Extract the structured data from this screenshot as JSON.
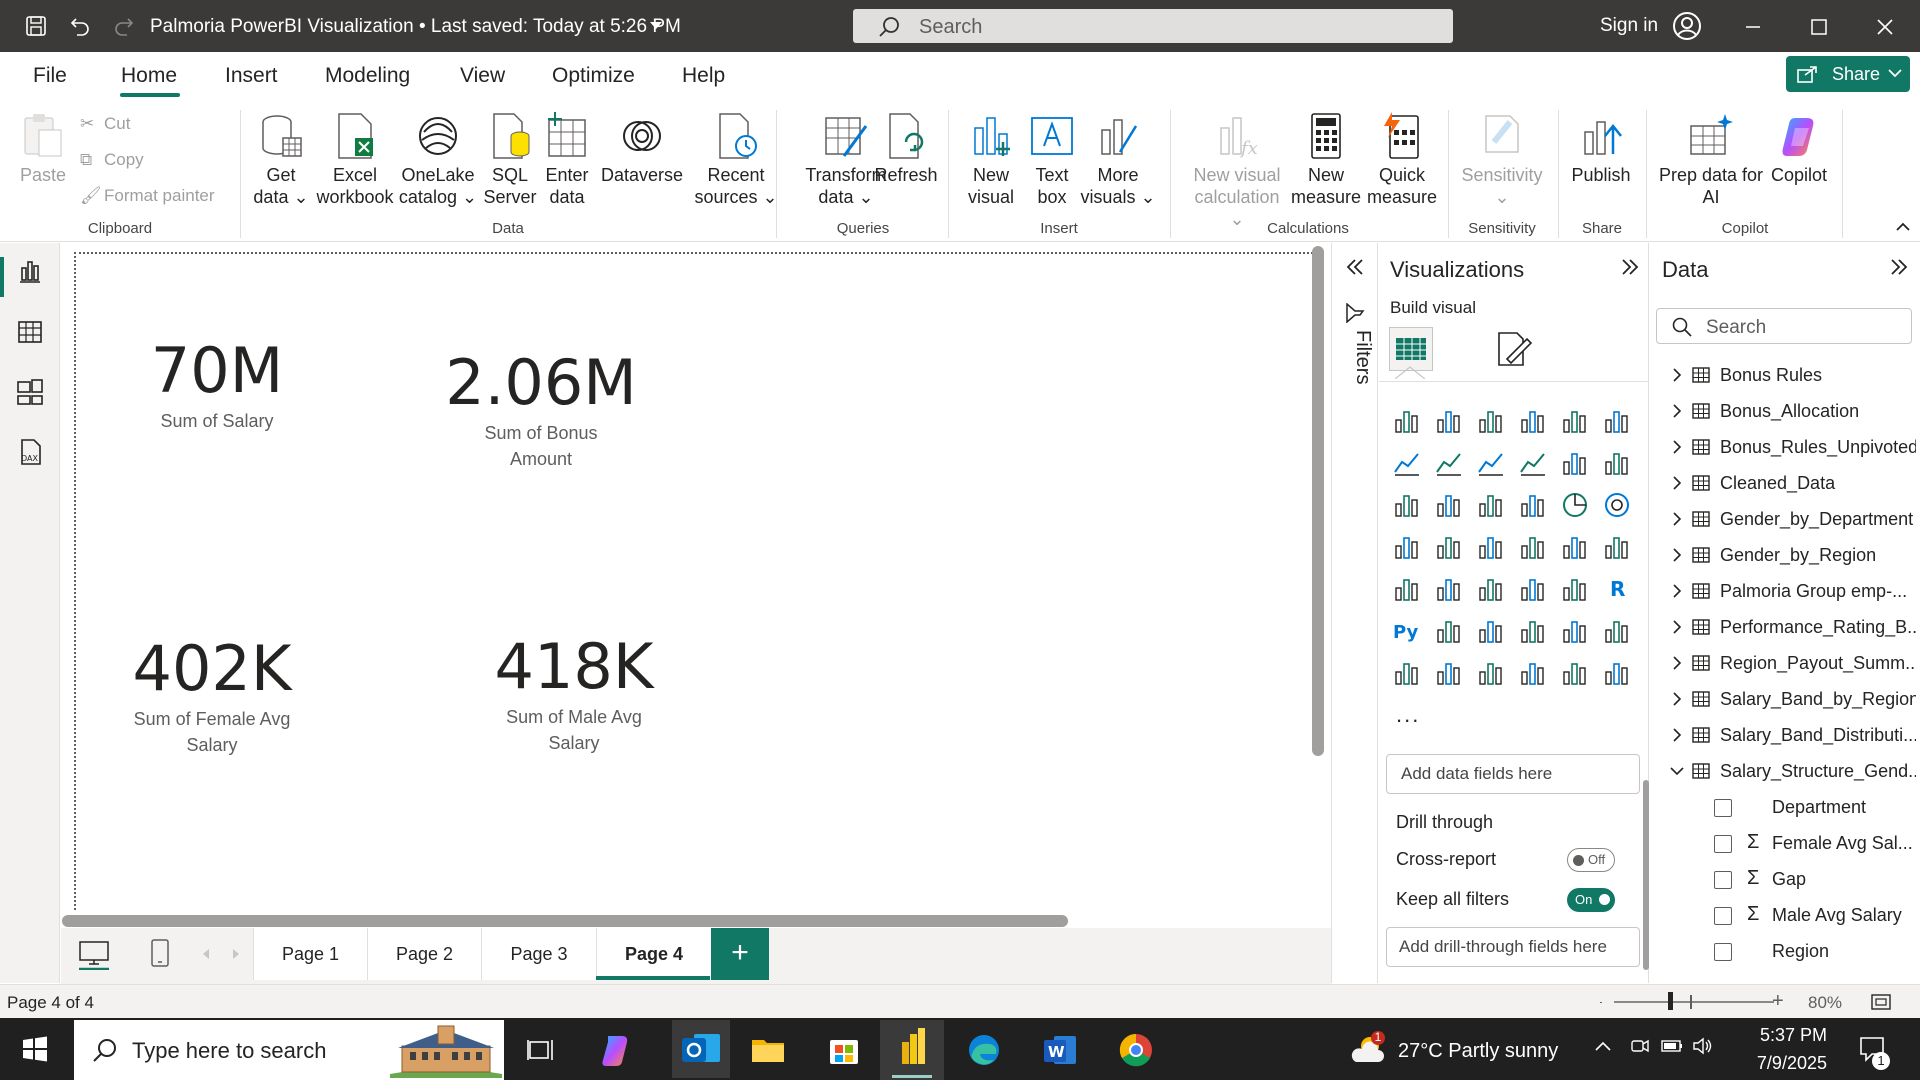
{
  "window": {
    "title": "Palmoria PowerBI Visualization • Last saved: Today at 5:26 PM",
    "search_placeholder": "Search",
    "sign_in": "Sign in"
  },
  "menu": {
    "tabs": [
      "File",
      "Home",
      "Insert",
      "Modeling",
      "View",
      "Optimize",
      "Help"
    ],
    "active": "Home",
    "share_label": "Share"
  },
  "ribbon": {
    "clipboard": {
      "paste": "Paste",
      "cut": "Cut",
      "copy": "Copy",
      "format_painter": "Format painter",
      "group": "Clipboard"
    },
    "data": {
      "get_data": [
        "Get",
        "data"
      ],
      "excel": [
        "Excel",
        "workbook"
      ],
      "onelake": [
        "OneLake",
        "catalog"
      ],
      "sql": [
        "SQL",
        "Server"
      ],
      "enter_data": [
        "Enter",
        "data"
      ],
      "dataverse": "Dataverse",
      "recent": [
        "Recent",
        "sources"
      ],
      "group": "Data"
    },
    "queries": {
      "transform": [
        "Transform",
        "data"
      ],
      "refresh": "Refresh",
      "group": "Queries"
    },
    "insert": {
      "new_visual": [
        "New",
        "visual"
      ],
      "text_box": [
        "Text",
        "box"
      ],
      "more_visuals": [
        "More",
        "visuals"
      ],
      "group": "Insert"
    },
    "calculations": {
      "new_visual_calc": [
        "New visual",
        "calculation"
      ],
      "new_measure": [
        "New",
        "measure"
      ],
      "quick_measure": [
        "Quick",
        "measure"
      ],
      "group": "Calculations"
    },
    "sensitivity": {
      "label": "Sensitivity",
      "group": "Sensitivity"
    },
    "share": {
      "publish": "Publish",
      "group": "Share"
    },
    "copilot": {
      "prep": [
        "Prep data for",
        "AI"
      ],
      "copilot": "Copilot",
      "group": "Copilot"
    }
  },
  "canvas": {
    "kpis": [
      {
        "value": "70M",
        "label": "Sum of Salary"
      },
      {
        "value": "2.06M",
        "label1": "Sum of Bonus",
        "label2": "Amount"
      },
      {
        "value": "402K",
        "label1": "Sum of Female Avg",
        "label2": "Salary"
      },
      {
        "value": "418K",
        "label1": "Sum of Male Avg",
        "label2": "Salary"
      }
    ]
  },
  "pages": {
    "tabs": [
      "Page 1",
      "Page 2",
      "Page 3",
      "Page 4"
    ],
    "active": "Page 4",
    "add": "+"
  },
  "filters": {
    "label": "Filters"
  },
  "visualizations": {
    "title": "Visualizations",
    "build_visual": "Build visual",
    "more": "...",
    "add_fields": "Add data fields here",
    "drill_through": "Drill through",
    "cross_report": "Cross-report",
    "cross_report_state": "Off",
    "keep_filters": "Keep all filters",
    "keep_filters_state": "On",
    "add_drill": "Add drill-through fields here"
  },
  "data_pane": {
    "title": "Data",
    "search_placeholder": "Search",
    "tables": [
      "Bonus Rules",
      "Bonus_Allocation",
      "Bonus_Rules_Unpivoted",
      "Cleaned_Data",
      "Gender_by_Department",
      "Gender_by_Region",
      "Palmoria Group emp-...",
      "Performance_Rating_B...",
      "Region_Payout_Summ...",
      "Salary_Band_by_Region",
      "Salary_Band_Distributi...",
      "Salary_Structure_Gend..."
    ],
    "expanded_fields": [
      {
        "name": "Department",
        "sigma": ""
      },
      {
        "name": "Female Avg Sal...",
        "sigma": "Σ"
      },
      {
        "name": "Gap",
        "sigma": "Σ"
      },
      {
        "name": "Male Avg Salary",
        "sigma": "Σ"
      },
      {
        "name": "Region",
        "sigma": ""
      }
    ]
  },
  "status": {
    "page_indicator": "Page 4 of 4",
    "zoom": "80%",
    "zoom_fraction": 0.8
  },
  "taskbar": {
    "search_placeholder": "Type here to search",
    "weather": "27°C  Partly sunny",
    "weather_badge": "1",
    "time": "5:37 PM",
    "date": "7/9/2025",
    "notifications": "1"
  },
  "colors": {
    "accent": "#117865",
    "titlebar": "#3b3a39",
    "taskbar": "#202020"
  }
}
